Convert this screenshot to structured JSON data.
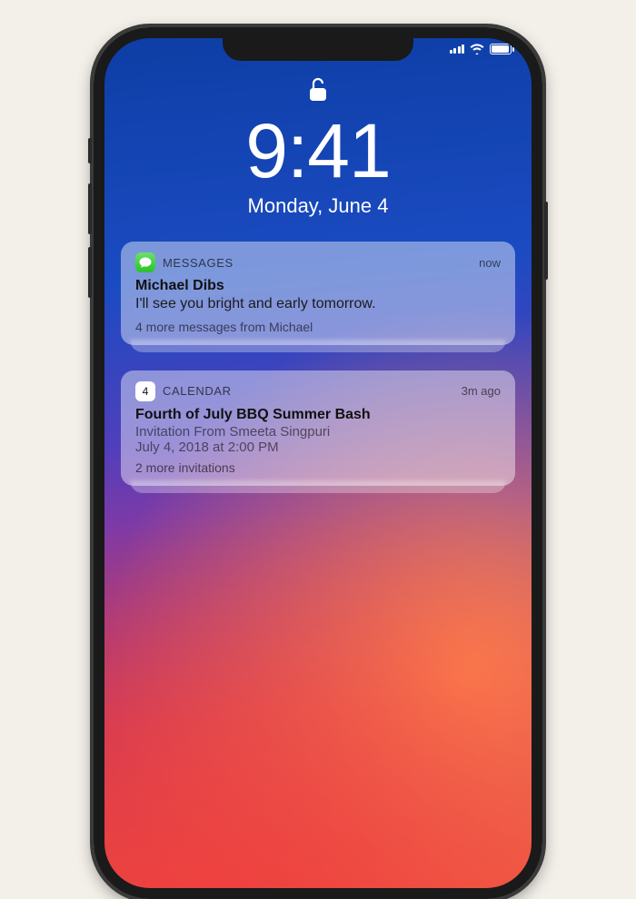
{
  "status": {
    "cell": 4,
    "wifi": 3,
    "battery": 100
  },
  "lock": {
    "time": "9:41",
    "date": "Monday, June 4"
  },
  "notifications": [
    {
      "app_label": "MESSAGES",
      "icon": "messages",
      "timestamp": "now",
      "title": "Michael Dibs",
      "body": "I'll see you bright and early tomorrow.",
      "stack_summary": "4 more messages from Michael"
    },
    {
      "app_label": "CALENDAR",
      "icon": "calendar",
      "icon_day": "4",
      "timestamp": "3m ago",
      "title": "Fourth of July BBQ Summer Bash",
      "subtitle": "Invitation From Smeeta Singpuri",
      "when": "July 4, 2018 at 2:00 PM",
      "stack_summary": "2 more invitations"
    }
  ]
}
